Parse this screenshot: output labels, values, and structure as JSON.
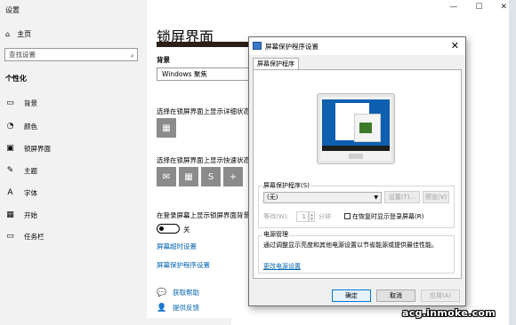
{
  "settings": {
    "title": "设置",
    "home": "主页",
    "search_placeholder": "查找设置",
    "section": "个性化",
    "nav": [
      {
        "label": "背景",
        "icon": "image-icon"
      },
      {
        "label": "颜色",
        "icon": "palette-icon"
      },
      {
        "label": "锁屏界面",
        "icon": "lock-screen-icon"
      },
      {
        "label": "主题",
        "icon": "theme-icon"
      },
      {
        "label": "字体",
        "icon": "font-icon"
      },
      {
        "label": "开始",
        "icon": "start-icon"
      },
      {
        "label": "任务栏",
        "icon": "taskbar-icon"
      }
    ],
    "page_title": "锁屏界面",
    "background_label": "背景",
    "background_value": "Windows 聚焦",
    "detail_status_label": "选择在锁屏界面上显示详细状态",
    "quick_status_label": "选择在锁屏界面上显示快速状态",
    "show_bg_label": "在登录屏幕上显示锁屏界面背景",
    "toggle_state": "关",
    "screen_timeout_link": "屏幕超时设置",
    "screensaver_link": "屏幕保护程序设置",
    "get_help": "获取帮助",
    "feedback": "提供反馈"
  },
  "dialog": {
    "title": "屏幕保护程序设置",
    "tab": "屏幕保护程序",
    "screensaver_group": "屏幕保护程序(S)",
    "screensaver_value": "(无)",
    "settings_btn": "设置(T)...",
    "preview_btn": "预览(V)",
    "wait_label": "等待(W):",
    "wait_value": "1",
    "minutes": "分钟",
    "resume_label": "在恢复时显示登录屏幕(R)",
    "power_group": "电源管理",
    "power_text": "通过调整显示亮度和其他电源设置以节省能源或提供最佳性能。",
    "power_link": "更改电源设置",
    "ok": "确定",
    "cancel": "取消",
    "apply": "应用(A)"
  },
  "watermark": "acg.inmoke.com"
}
